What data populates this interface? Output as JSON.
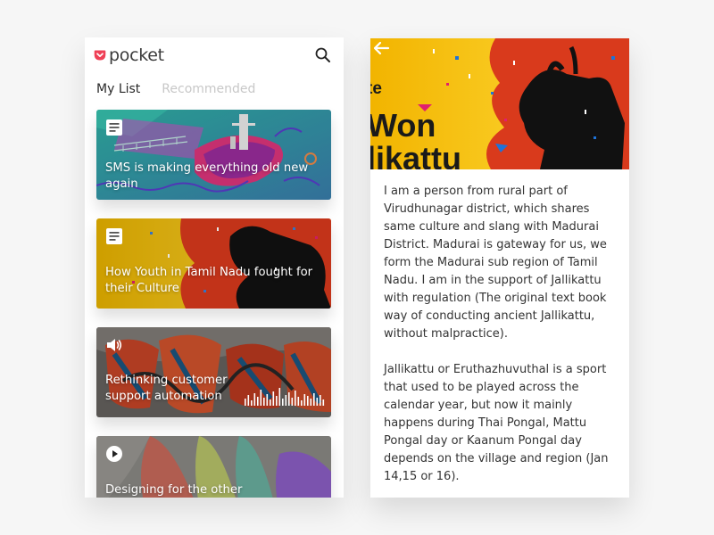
{
  "app": {
    "name": "pocket",
    "brand_color": "#ef4056"
  },
  "left_screen": {
    "tabs": [
      {
        "label": "My List",
        "active": true
      },
      {
        "label": "Recommended",
        "active": false
      }
    ],
    "search_icon": "search-icon",
    "cards": [
      {
        "title": "SMS is making everything old new again",
        "type_icon": "article-icon"
      },
      {
        "title": "How Youth in Tamil Nadu fought for their Culture",
        "type_icon": "article-icon"
      },
      {
        "title": "Rethinking customer support automation",
        "type_icon": "audio-icon"
      },
      {
        "title": "Designing for the other",
        "type_icon": "play-icon"
      }
    ]
  },
  "right_screen": {
    "back_icon": "back-arrow-icon",
    "hero": {
      "text_fragments": [
        "te",
        "Won",
        "likattu"
      ]
    },
    "paragraphs": [
      "I am a person from rural part of Virudhunagar district, which shares same culture and slang with Madurai District. Madurai is gateway for us, we form the Madurai sub region of Tamil Nadu. I am in the support of Jallikattu with regulation (The original text book way of conducting ancient Jallikattu, without malpractice).",
      "Jallikattu or Eruthazhuvuthal is a sport that used to be played across the calendar year, but now it mainly happens during Thai Pongal, Mattu Pongal day or Kaanum Pongal day depends on the village and region (Jan 14,15 or 16)."
    ]
  }
}
